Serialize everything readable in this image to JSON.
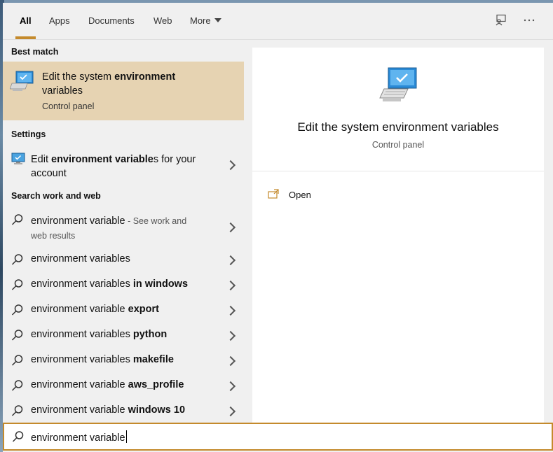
{
  "tabs": [
    {
      "label": "All"
    },
    {
      "label": "Apps"
    },
    {
      "label": "Documents"
    },
    {
      "label": "Web"
    },
    {
      "label": "More"
    }
  ],
  "sections": {
    "best_match": "Best match",
    "settings": "Settings",
    "search_web": "Search work and web"
  },
  "best_match": {
    "title_pre": "Edit the system ",
    "title_bold": "environment",
    "title_line2": "variables",
    "subtitle": "Control panel"
  },
  "settings_item": {
    "pre": "Edit ",
    "bold": "environment variable",
    "post": "s for your",
    "line2": "account"
  },
  "web_first": {
    "text": "environment variable",
    "suffix": " - See work and",
    "line2": "web results"
  },
  "suggestions": [
    {
      "base": "environment variables",
      "bold": ""
    },
    {
      "base": "environment variables ",
      "bold": "in windows"
    },
    {
      "base": "environment variable ",
      "bold": "export"
    },
    {
      "base": "environment variables ",
      "bold": "python"
    },
    {
      "base": "environment variables ",
      "bold": "makefile"
    },
    {
      "base": "environment variable ",
      "bold": "aws_profile"
    },
    {
      "base": "environment variable ",
      "bold": "windows 10"
    }
  ],
  "preview": {
    "title": "Edit the system environment variables",
    "subtitle": "Control panel",
    "action_open": "Open"
  },
  "search": {
    "value": "environment variable"
  },
  "colors": {
    "accent": "#c48a2c",
    "highlight": "#e6d3b2"
  }
}
